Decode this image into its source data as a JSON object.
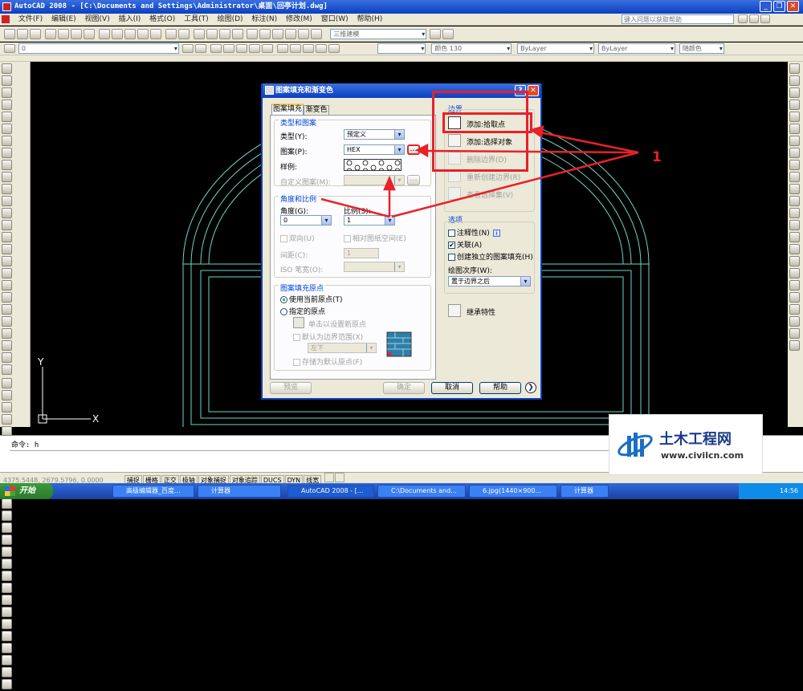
{
  "window": {
    "title": "AutoCAD 2008 - [C:\\Documents and Settings\\Administrator\\桌面\\回亭计划.dwg]"
  },
  "menu": [
    "文件(F)",
    "编辑(E)",
    "视图(V)",
    "插入(I)",
    "格式(O)",
    "工具(T)",
    "绘图(D)",
    "标注(N)",
    "修改(M)",
    "窗口(W)",
    "帮助(H)"
  ],
  "help_box": {
    "placeholder": "键入问题以获取帮助"
  },
  "toolbar": {
    "workspace": "三维建模",
    "layer": "0",
    "color": "颜色 130",
    "linetype1": "ByLayer",
    "linetype2": "ByLayer",
    "plotstyle": "随颜色"
  },
  "dialog": {
    "title": "图案填充和渐变色",
    "tabs": [
      "图案填充",
      "渐变色"
    ],
    "type_pattern": {
      "title": "类型和图案",
      "type_label": "类型(Y):",
      "type_value": "预定义",
      "pattern_label": "图案(P):",
      "pattern_value": "HEX",
      "swatch_label": "样例:",
      "custom_label": "自定义图案(M):"
    },
    "angle_scale": {
      "title": "角度和比例",
      "angle_label": "角度(G):",
      "angle_value": "0",
      "scale_label": "比例(S):",
      "scale_value": "1",
      "double_label": "双向(U)",
      "relative_label": "相对图纸空间(E)",
      "spacing_label": "间距(C):",
      "spacing_value": "1",
      "iso_label": "ISO 笔宽(O):"
    },
    "origin": {
      "title": "图案填充原点",
      "current_label": "使用当前原点(T)",
      "specified_label": "指定的原点",
      "click_label": "单击以设置新原点",
      "default_label": "默认为边界范围(X)",
      "position_value": "左下",
      "store_label": "存储为默认原点(F)"
    },
    "boundary": {
      "title": "边界",
      "pick_label": "添加:拾取点",
      "select_label": "添加:选择对象",
      "remove_label": "删除边界(D)",
      "recreate_label": "重新创建边界(R)",
      "view_label": "查看选择集(V)"
    },
    "options": {
      "title": "选项",
      "annotative_label": "注释性(N)",
      "associative_label": "关联(A)",
      "separate_label": "创建独立的图案填充(H)",
      "order_title": "绘图次序(W):",
      "order_value": "置于边界之后"
    },
    "inherit_label": "继承特性",
    "buttons": {
      "preview": "预览",
      "ok": "确定",
      "cancel": "取消",
      "help": "帮助"
    }
  },
  "annotation": {
    "number": "1"
  },
  "drawing": {
    "y_axis": "Y",
    "x_axis": "X"
  },
  "command": {
    "line": "命令: h"
  },
  "status": {
    "coords": "4375.5448, 2679.5796, 0.0000",
    "toggles": [
      "捕捉",
      "栅格",
      "正交",
      "极轴",
      "对象捕捉",
      "对象追踪",
      "DUCS",
      "DYN",
      "线宽"
    ]
  },
  "taskbar": {
    "start": "开始",
    "tasks": [
      "高级编辑器_百度...",
      "计算器",
      "AutoCAD 2008 - [...",
      "C:\\Documents and...",
      "6.jpg(1440×900...",
      "计算器"
    ],
    "time": "14:56"
  },
  "watermark": {
    "name": "土木工程网",
    "url": "www.civilcn.com"
  },
  "colors": {
    "hatch_lines": "#6bd7c9",
    "annotation_red": "#e8212a",
    "title_blue": "#0a3fc0"
  }
}
